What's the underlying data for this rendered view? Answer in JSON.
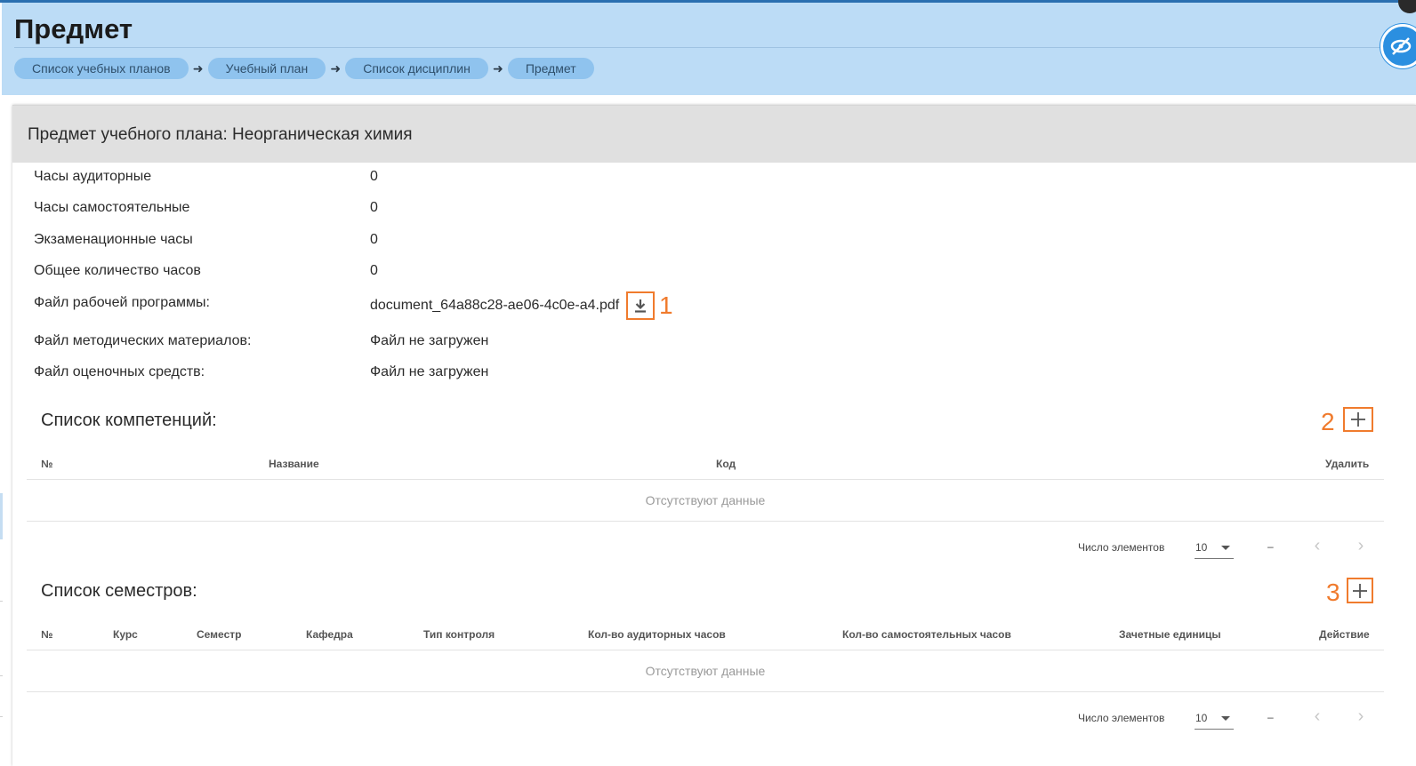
{
  "header": {
    "title": "Предмет",
    "breadcrumbs": [
      "Список учебных планов",
      "Учебный план",
      "Список дисциплин",
      "Предмет"
    ]
  },
  "card": {
    "title": "Предмет учебного плана: Неорганическая химия",
    "info": [
      {
        "label": "Часы аудиторные",
        "value": "0"
      },
      {
        "label": "Часы самостоятельные",
        "value": "0"
      },
      {
        "label": "Экзаменационные часы",
        "value": "0"
      },
      {
        "label": "Общее количество часов",
        "value": "0"
      },
      {
        "label": "Файл рабочей программы:",
        "value": "document_64a88c28-ae06-4c0e-a4.pdf"
      },
      {
        "label": "Файл методических материалов:",
        "value": "Файл не загружен"
      },
      {
        "label": "Файл оценочных средств:",
        "value": "Файл не загружен"
      }
    ],
    "annotations": {
      "download": "1",
      "add_competence": "2",
      "add_semester": "3"
    }
  },
  "competencies": {
    "title": "Список компетенций:",
    "columns": [
      "№",
      "Название",
      "Код",
      "Удалить"
    ],
    "empty_text": "Отсутствуют данные",
    "pager": {
      "label": "Число элементов",
      "page_size": "10",
      "range": "–"
    }
  },
  "semesters": {
    "title": "Список семестров:",
    "columns": [
      "№",
      "Курс",
      "Семестр",
      "Кафедра",
      "Тип контроля",
      "Кол-во аудиторных часов",
      "Кол-во самостоятельных часов",
      "Зачетные единицы",
      "Действие"
    ],
    "empty_text": "Отсутствуют данные",
    "pager": {
      "label": "Число элементов",
      "page_size": "10",
      "range": "–"
    }
  },
  "colors": {
    "header_bg": "#bcdcf6",
    "crumb_bg": "#8fc3ee",
    "annotation": "#f07b2d",
    "card_head_bg": "#e0e0e0"
  },
  "icons": [
    "chevron-right-icon",
    "eye-slash-icon",
    "download-icon",
    "plus-icon",
    "caret-down-icon",
    "chevron-left-icon"
  ]
}
